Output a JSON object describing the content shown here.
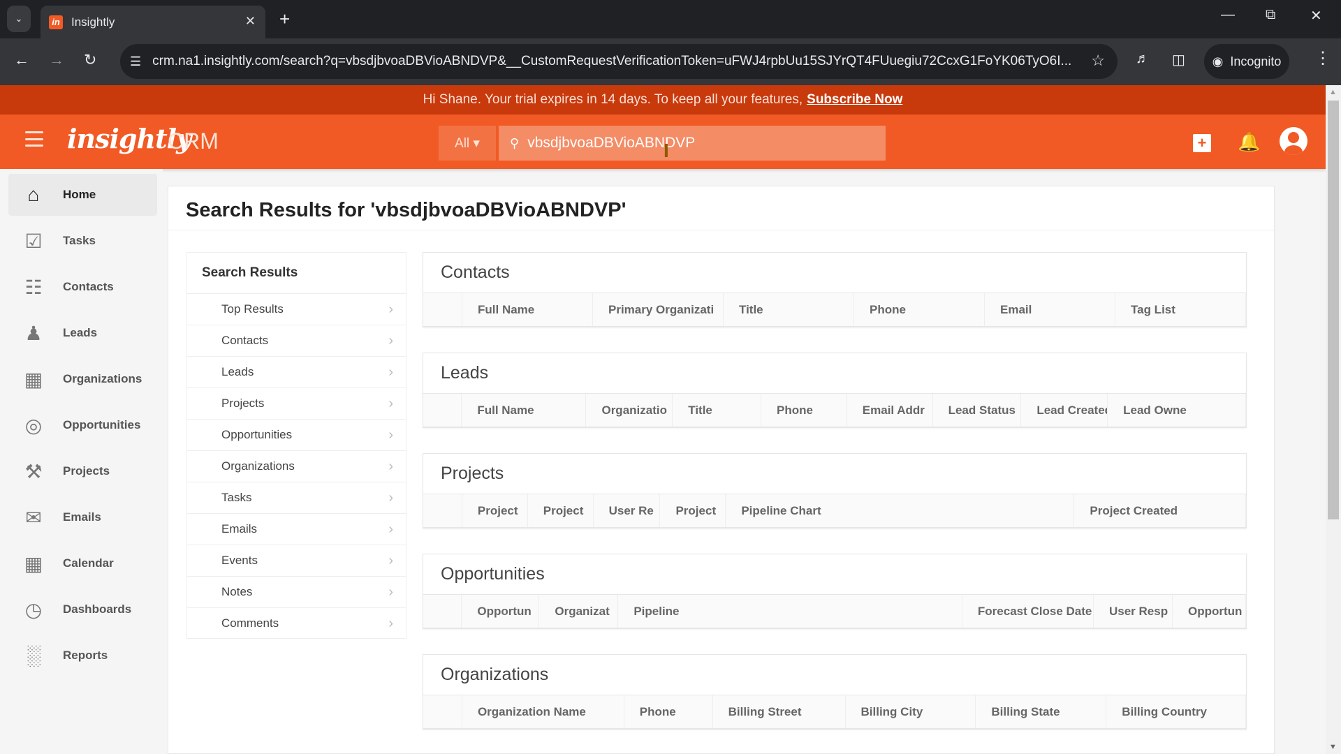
{
  "browser": {
    "tab_title": "Insightly",
    "favicon_letter": "in",
    "url": "crm.na1.insightly.com/search?q=vbsdjbvoaDBVioABNDVP&__CustomRequestVerificationToken=uFWJ4rpbUu15SJYrQT4FUuegiu72CcxG1FoYK06TyO6I...",
    "incognito_label": "Incognito"
  },
  "banner": {
    "text": "Hi Shane. Your trial expires in 14 days. To keep all your features,",
    "link": "Subscribe Now"
  },
  "header": {
    "logo": "insightly",
    "product": "CRM",
    "search_scope": "All ▾",
    "search_value": "vbsdjbvoaDBVioABNDVP"
  },
  "sidebar": {
    "items": [
      {
        "label": "Home",
        "icon": "home-icon",
        "glyph": "⌂"
      },
      {
        "label": "Tasks",
        "icon": "tasks-icon",
        "glyph": "☑"
      },
      {
        "label": "Contacts",
        "icon": "contacts-icon",
        "glyph": "☷"
      },
      {
        "label": "Leads",
        "icon": "leads-icon",
        "glyph": "♟"
      },
      {
        "label": "Organizations",
        "icon": "organizations-icon",
        "glyph": "▦"
      },
      {
        "label": "Opportunities",
        "icon": "opportunities-icon",
        "glyph": "◎"
      },
      {
        "label": "Projects",
        "icon": "projects-icon",
        "glyph": "⚒"
      },
      {
        "label": "Emails",
        "icon": "emails-icon",
        "glyph": "✉"
      },
      {
        "label": "Calendar",
        "icon": "calendar-icon",
        "glyph": "▦"
      },
      {
        "label": "Dashboards",
        "icon": "dashboards-icon",
        "glyph": "◷"
      },
      {
        "label": "Reports",
        "icon": "reports-icon",
        "glyph": "░"
      }
    ]
  },
  "main": {
    "title": "Search Results for 'vbsdjbvoaDBVioABNDVP'",
    "results_panel": {
      "heading": "Search Results",
      "items": [
        "Top Results",
        "Contacts",
        "Leads",
        "Projects",
        "Opportunities",
        "Organizations",
        "Tasks",
        "Emails",
        "Events",
        "Notes",
        "Comments"
      ]
    },
    "sections": [
      {
        "title": "Contacts",
        "columns": [
          "Full Name",
          "Primary Organizati",
          "Title",
          "Phone",
          "Email",
          "Tag List"
        ]
      },
      {
        "title": "Leads",
        "columns": [
          "Full Name",
          "Organizatio",
          "Title",
          "Phone",
          "Email Addr",
          "Lead Status",
          "Lead Created",
          "Lead Owne"
        ]
      },
      {
        "title": "Projects",
        "columns": [
          "Project",
          "Project",
          "User Re",
          "Project",
          "Pipeline Chart",
          "Project Created"
        ]
      },
      {
        "title": "Opportunities",
        "columns": [
          "Opportun",
          "Organizat",
          "Pipeline",
          "Forecast Close Date",
          "User Resp",
          "Opportun"
        ]
      },
      {
        "title": "Organizations",
        "columns": [
          "Organization Name",
          "Phone",
          "Billing Street",
          "Billing City",
          "Billing State",
          "Billing Country"
        ]
      }
    ]
  }
}
